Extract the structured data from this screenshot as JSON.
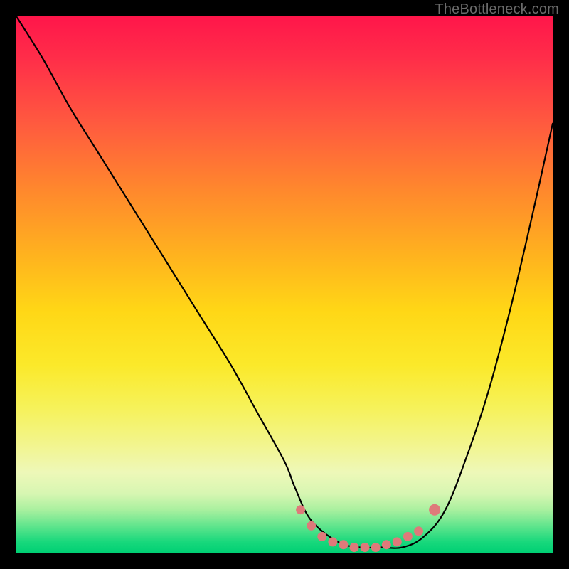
{
  "attribution": "TheBottleneck.com",
  "colors": {
    "frame": "#000000",
    "attribution_text": "#6b6b6b",
    "curve": "#000000",
    "marker_fill": "#de7a7a",
    "marker_stroke": "#d46a6a",
    "gradient_stops": [
      "#ff164a",
      "#ff2e49",
      "#ff5a3f",
      "#ff8a2c",
      "#ffb41e",
      "#ffd716",
      "#fbe92a",
      "#f6f25a",
      "#f2f58f",
      "#eef8b8",
      "#d7f6b2",
      "#a9f09f",
      "#61e58d",
      "#18d87c",
      "#00d074"
    ]
  },
  "chart_data": {
    "type": "line",
    "title": "",
    "xlabel": "",
    "ylabel": "",
    "xlim": [
      0,
      100
    ],
    "ylim": [
      0,
      100
    ],
    "grid": false,
    "series": [
      {
        "name": "bottleneck-curve",
        "x": [
          0,
          5,
          10,
          15,
          20,
          25,
          30,
          35,
          40,
          45,
          50,
          52,
          55,
          60,
          64,
          68,
          72,
          76,
          80,
          84,
          88,
          92,
          96,
          100
        ],
        "y": [
          100,
          92,
          83,
          75,
          67,
          59,
          51,
          43,
          35,
          26,
          17,
          12,
          6,
          2,
          1,
          1,
          1,
          3,
          8,
          18,
          30,
          45,
          62,
          80
        ]
      }
    ],
    "markers": [
      {
        "x": 53,
        "y": 8
      },
      {
        "x": 55,
        "y": 5
      },
      {
        "x": 57,
        "y": 3
      },
      {
        "x": 59,
        "y": 2
      },
      {
        "x": 61,
        "y": 1.5
      },
      {
        "x": 63,
        "y": 1
      },
      {
        "x": 65,
        "y": 1
      },
      {
        "x": 67,
        "y": 1
      },
      {
        "x": 69,
        "y": 1.5
      },
      {
        "x": 71,
        "y": 2
      },
      {
        "x": 73,
        "y": 3
      },
      {
        "x": 75,
        "y": 4
      },
      {
        "x": 78,
        "y": 8
      }
    ],
    "annotations": []
  }
}
